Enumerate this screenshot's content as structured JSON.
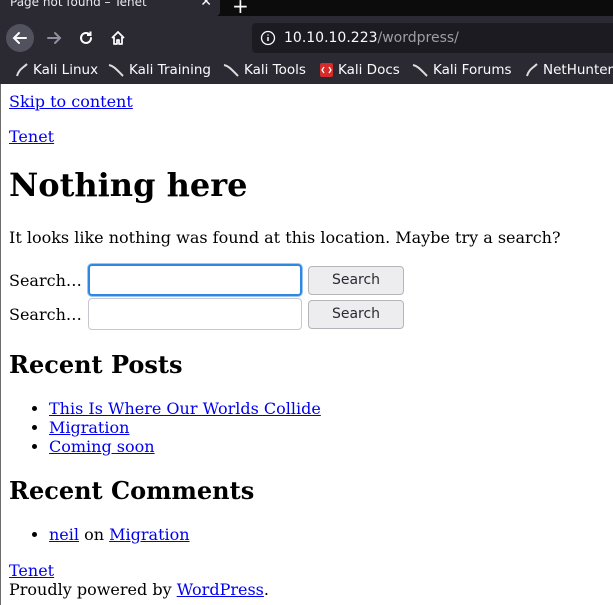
{
  "browser": {
    "tab_title": "Page not found – Tenet",
    "url_host": "10.10.10.223",
    "url_path": "/wordpress/",
    "bookmarks": [
      "Kali Linux",
      "Kali Training",
      "Kali Tools",
      "Kali Docs",
      "Kali Forums",
      "NetHunter"
    ]
  },
  "page": {
    "skip_link": "Skip to content",
    "site_title": "Tenet",
    "heading": "Nothing here",
    "message": "It looks like nothing was found at this location. Maybe try a search?",
    "search_label": "Search…",
    "search_button": "Search",
    "recent_posts_heading": "Recent Posts",
    "recent_posts": [
      "This Is Where Our Worlds Collide",
      "Migration",
      "Coming soon"
    ],
    "recent_comments_heading": "Recent Comments",
    "comment": {
      "author": "neil",
      "on": "on",
      "post": "Migration"
    },
    "footer_title": "Tenet",
    "powered_prefix": "Proudly powered by ",
    "powered_link": "WordPress",
    "powered_suffix": "."
  }
}
